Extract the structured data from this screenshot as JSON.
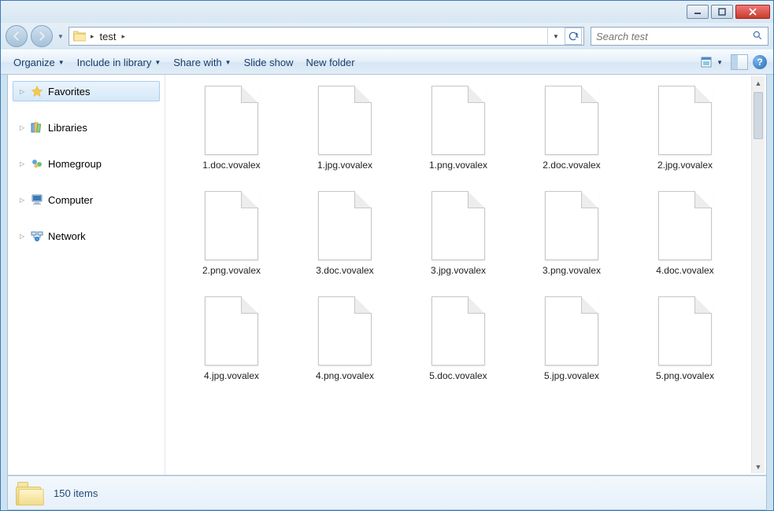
{
  "breadcrumb": {
    "segment": "test",
    "chevron": "▸"
  },
  "search": {
    "placeholder": "Search test"
  },
  "toolbar": {
    "organize": "Organize",
    "include": "Include in library",
    "share": "Share with",
    "slideshow": "Slide show",
    "newfolder": "New folder"
  },
  "sidebar": {
    "favorites": "Favorites",
    "libraries": "Libraries",
    "homegroup": "Homegroup",
    "computer": "Computer",
    "network": "Network"
  },
  "files": [
    "1.doc.vovalex",
    "1.jpg.vovalex",
    "1.png.vovalex",
    "2.doc.vovalex",
    "2.jpg.vovalex",
    "2.png.vovalex",
    "3.doc.vovalex",
    "3.jpg.vovalex",
    "3.png.vovalex",
    "4.doc.vovalex",
    "4.jpg.vovalex",
    "4.png.vovalex",
    "5.doc.vovalex",
    "5.jpg.vovalex",
    "5.png.vovalex"
  ],
  "status": {
    "items": "150 items"
  }
}
